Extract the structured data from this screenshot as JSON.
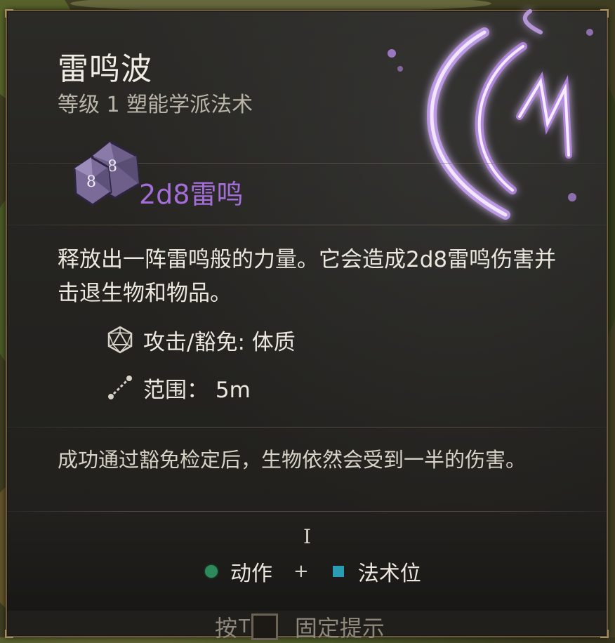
{
  "spell": {
    "name": "雷鸣波",
    "subtitle": "等级 1 塑能学派法术",
    "damage": "2d8雷鸣",
    "description": "释放出一阵雷鸣般的力量。它会造成2d8雷鸣伤害并击退生物和物品。",
    "properties": [
      {
        "icon": "d20-save-icon",
        "label": "攻击/豁免: 体质"
      },
      {
        "icon": "range-icon",
        "label": "范围： 5m"
      }
    ],
    "note": "成功通过豁免检定后，生物依然会受到一半的伤害。"
  },
  "cost": {
    "level_numeral": "I",
    "action_label": "动作",
    "separator": "+",
    "slot_label": "法术位"
  },
  "hint": {
    "prefix": "按",
    "key": "T",
    "suffix": "固定提示"
  },
  "colors": {
    "damage_purple": "#a36ed8",
    "action_green": "#2e8a5a",
    "slot_blue": "#2a9bb0",
    "border_gold": "#6b5a3e"
  }
}
